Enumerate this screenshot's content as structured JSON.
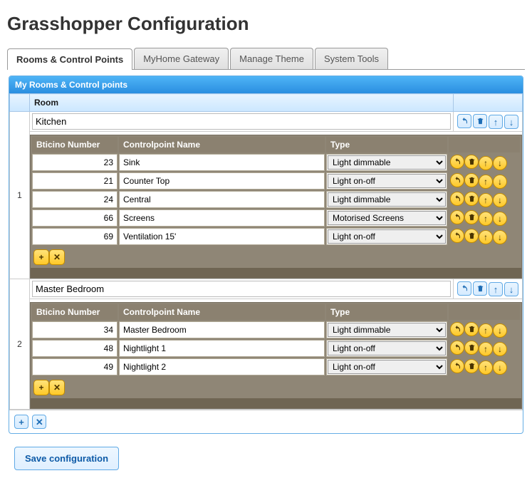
{
  "pageTitle": "Grasshopper Configuration",
  "tabs": [
    {
      "label": "Rooms & Control Points",
      "active": true
    },
    {
      "label": "MyHome Gateway",
      "active": false
    },
    {
      "label": "Manage Theme",
      "active": false
    },
    {
      "label": "System Tools",
      "active": false
    }
  ],
  "panelTitle": "My Rooms & Control points",
  "roomHeader": "Room",
  "cpHeaders": {
    "number": "Bticino Number",
    "name": "Controlpoint Name",
    "type": "Type"
  },
  "typeOptions": [
    "Light dimmable",
    "Light on-off",
    "Motorised Screens"
  ],
  "rooms": [
    {
      "idx": "1",
      "name": "Kitchen",
      "cps": [
        {
          "num": "23",
          "name": "Sink",
          "type": "Light dimmable"
        },
        {
          "num": "21",
          "name": "Counter Top",
          "type": "Light on-off"
        },
        {
          "num": "24",
          "name": "Central",
          "type": "Light dimmable"
        },
        {
          "num": "66",
          "name": "Screens",
          "type": "Motorised Screens"
        },
        {
          "num": "69",
          "name": "Ventilation 15'",
          "type": "Light on-off"
        }
      ]
    },
    {
      "idx": "2",
      "name": "Master Bedroom",
      "cps": [
        {
          "num": "34",
          "name": "Master Bedroom",
          "type": "Light dimmable"
        },
        {
          "num": "48",
          "name": "Nightlight 1",
          "type": "Light on-off"
        },
        {
          "num": "49",
          "name": "Nightlight 2",
          "type": "Light on-off"
        }
      ]
    }
  ],
  "saveLabel": "Save configuration"
}
